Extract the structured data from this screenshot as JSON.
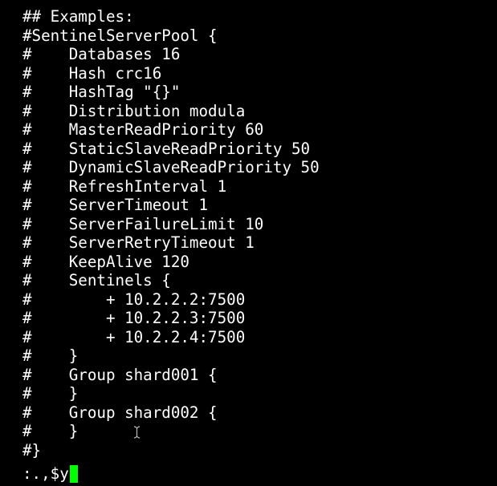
{
  "editor": {
    "lines": [
      "## Examples:",
      "#SentinelServerPool {",
      "#    Databases 16",
      "#    Hash crc16",
      "#    HashTag \"{}\"",
      "#    Distribution modula",
      "#    MasterReadPriority 60",
      "#    StaticSlaveReadPriority 50",
      "#    DynamicSlaveReadPriority 50",
      "#    RefreshInterval 1",
      "#    ServerTimeout 1",
      "#    ServerFailureLimit 10",
      "#    ServerRetryTimeout 1",
      "#    KeepAlive 120",
      "#    Sentinels {",
      "#        + 10.2.2.2:7500",
      "#        + 10.2.2.3:7500",
      "#        + 10.2.2.4:7500",
      "#    }",
      "#    Group shard001 {",
      "#    }",
      "#    Group shard002 {",
      "#    }",
      "#}"
    ]
  },
  "command_line": {
    "text": ":.,$y",
    "cursor_color": "#00ff00"
  },
  "colors": {
    "background": "#000000",
    "text": "#ffffff"
  },
  "icons": {
    "mouse_pointer": "ibeam-cursor-icon"
  }
}
